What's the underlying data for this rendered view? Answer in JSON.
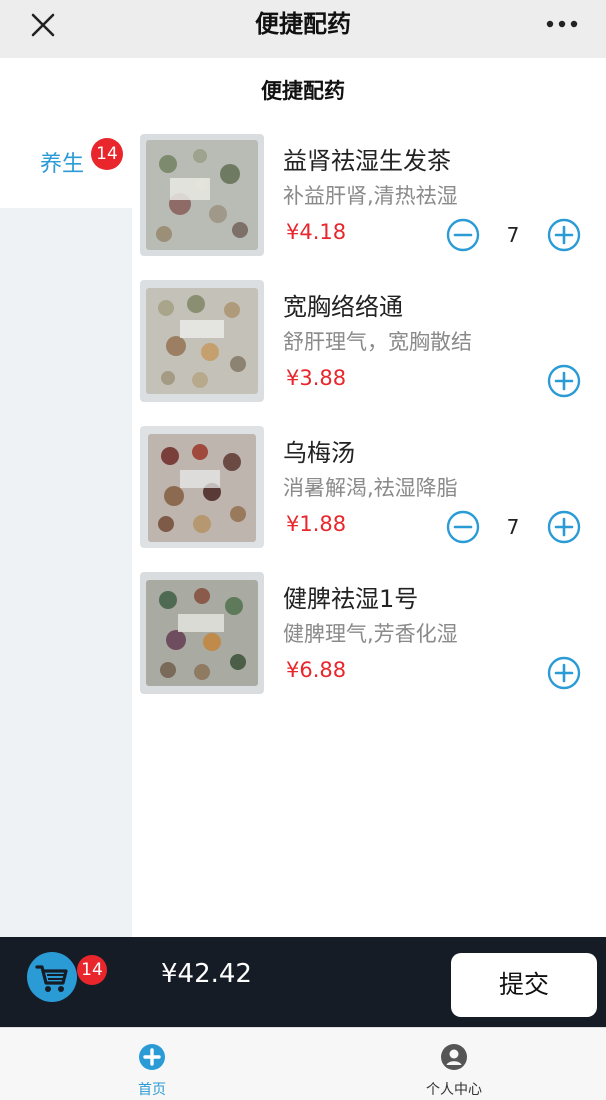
{
  "titlebar": {
    "title": "便捷配药",
    "close_icon": "close-icon",
    "more_icon": "more-icon"
  },
  "page_heading": "便捷配药",
  "sidebar": {
    "items": [
      {
        "label": "养生",
        "badge": "14",
        "selected": true
      }
    ]
  },
  "products": [
    {
      "name": "益肾祛湿生发茶",
      "desc": "补益肝肾,清热祛湿",
      "price": "¥4.18",
      "quantity": "7",
      "has_quantity": true
    },
    {
      "name": "宽胸络络通",
      "desc": "舒肝理气，宽胸散结",
      "price": "¥3.88",
      "quantity": "",
      "has_quantity": false
    },
    {
      "name": "乌梅汤",
      "desc": "消暑解渴,祛湿降脂",
      "price": "¥1.88",
      "quantity": "7",
      "has_quantity": true
    },
    {
      "name": "健脾祛湿1号",
      "desc": "健脾理气,芳香化湿",
      "price": "¥6.88",
      "quantity": "",
      "has_quantity": false
    }
  ],
  "cart": {
    "badge": "14",
    "total": "¥42.42",
    "submit_label": "提交"
  },
  "tabs": [
    {
      "label": "首页",
      "icon": "home-plus-icon",
      "active": true
    },
    {
      "label": "个人中心",
      "icon": "user-icon",
      "active": false
    }
  ],
  "colors": {
    "accent": "#2b9bd6",
    "price_red": "#e8262c",
    "cart_bar": "#151c26",
    "sidebar_bg": "#eff2f5"
  }
}
